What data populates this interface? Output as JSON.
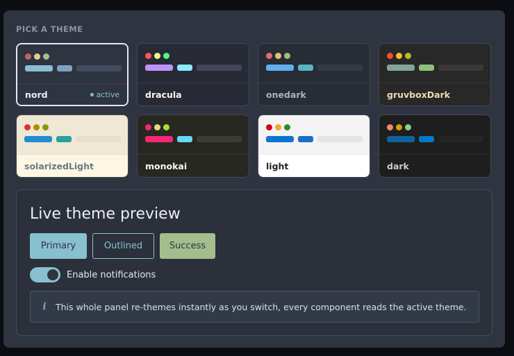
{
  "section_title": "PICK A THEME",
  "themes": [
    {
      "name": "nord",
      "active": true,
      "active_label": "active",
      "top_bg": "#2e3440",
      "bottom_bg": "#2e3440",
      "name_color": "#eceff4",
      "dots": [
        "#bf616a",
        "#ebcb8b",
        "#a3be8c"
      ],
      "bars": [
        "#88c0d0",
        "#81a1c1",
        "#434c5e"
      ]
    },
    {
      "name": "dracula",
      "top_bg": "#282a36",
      "bottom_bg": "#282a36",
      "name_color": "#f8f8f2",
      "dots": [
        "#ff5555",
        "#f1fa8c",
        "#50fa7b"
      ],
      "bars": [
        "#bd93f9",
        "#8be9fd",
        "#44475a"
      ]
    },
    {
      "name": "onedark",
      "top_bg": "#282c34",
      "bottom_bg": "#282c34",
      "name_color": "#abb2bf",
      "dots": [
        "#e06c75",
        "#e5c07b",
        "#98c379"
      ],
      "bars": [
        "#61afef",
        "#56b6c2",
        "#353b45"
      ]
    },
    {
      "name": "gruvboxDark",
      "top_bg": "#282828",
      "bottom_bg": "#282828",
      "name_color": "#ebdbb2",
      "dots": [
        "#fb4934",
        "#fabd2f",
        "#b8bb26"
      ],
      "bars": [
        "#83a598",
        "#8ec07c",
        "#3c3836"
      ]
    },
    {
      "name": "solarizedLight",
      "light": true,
      "top_bg": "#eee8d5",
      "bottom_bg": "#fdf6e3",
      "name_color": "#657b83",
      "dots": [
        "#dc322f",
        "#b58900",
        "#859900"
      ],
      "bars": [
        "#268bd2",
        "#2aa198",
        "#e6dfcb"
      ]
    },
    {
      "name": "monokai",
      "top_bg": "#272822",
      "bottom_bg": "#272822",
      "name_color": "#f8f8f2",
      "dots": [
        "#f92672",
        "#e6db74",
        "#a6e22e"
      ],
      "bars": [
        "#f92672",
        "#66d9ef",
        "#3e3d32"
      ]
    },
    {
      "name": "light",
      "light": true,
      "top_bg": "#f3f3f3",
      "bottom_bg": "#ffffff",
      "name_color": "#1f2328",
      "dots": [
        "#d0021b",
        "#f5a623",
        "#2e8b2e"
      ],
      "bars": [
        "#0b75d0",
        "#1a6fc7",
        "#e4e4e4"
      ]
    },
    {
      "name": "dark",
      "top_bg": "#1e1e1e",
      "bottom_bg": "#1e1e1e",
      "name_color": "#cccccc",
      "dots": [
        "#f48771",
        "#cca700",
        "#89d185"
      ],
      "bars": [
        "#0e639c",
        "#007acc",
        "#252526"
      ]
    }
  ],
  "preview": {
    "title": "Live theme preview",
    "buttons": {
      "primary": "Primary",
      "outlined": "Outlined",
      "success": "Success"
    },
    "toggle_label": "Enable notifications",
    "toggle_on": true,
    "info_icon": "info-icon",
    "info_glyph": "i",
    "info_text": "This whole panel re-themes instantly as you switch, every component reads the active theme."
  }
}
